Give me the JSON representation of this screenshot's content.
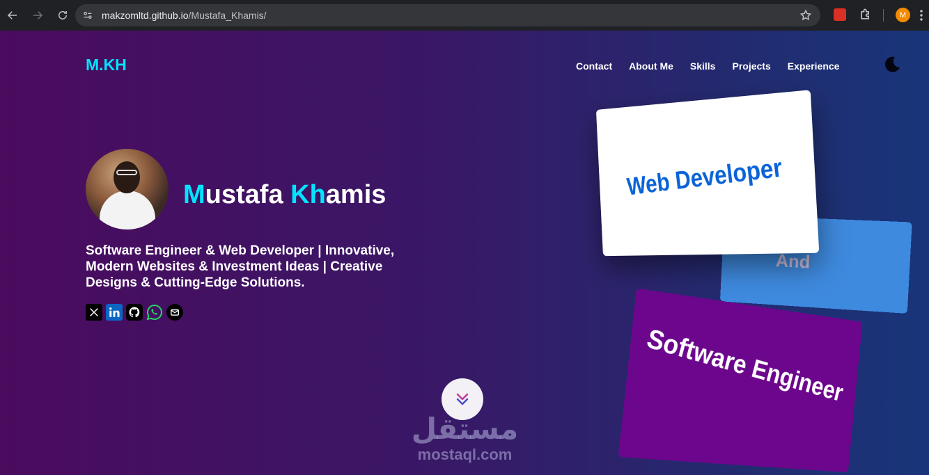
{
  "browser": {
    "url_host": "makzomltd.github.io",
    "url_path": "/Mustafa_Khamis/",
    "profile_initial": "M",
    "icons": [
      "back-icon",
      "forward-icon",
      "reload-icon",
      "site-info-icon",
      "star-icon",
      "extension-icon",
      "puzzle-icon",
      "menu-icon"
    ]
  },
  "header": {
    "logo": "M.KH",
    "nav": [
      "Contact",
      "About Me",
      "Skills",
      "Projects",
      "Experience"
    ],
    "theme_icon": "moon-icon"
  },
  "hero": {
    "name_first_hl": "M",
    "name_first_rest": "ustafa ",
    "name_last_hl": "Kh",
    "name_last_rest": "amis",
    "tagline": "Software Engineer & Web Developer | Innovative, Modern Websites & Investment Ideas | Creative Designs & Cutting-Edge Solutions.",
    "socials": [
      "x-icon",
      "linkedin-icon",
      "github-icon",
      "whatsapp-icon",
      "email-icon"
    ]
  },
  "cards": {
    "web": "Web Developer",
    "and": "And",
    "se": "Software Engineer"
  },
  "watermark": {
    "arabic": "مستقل",
    "latin": "mostaql.com"
  },
  "colors": {
    "accent": "#00e5ff",
    "card_web_text": "#0a63d6",
    "card_and_bg": "#3e8adf",
    "card_se_bg": "#6c068c"
  }
}
